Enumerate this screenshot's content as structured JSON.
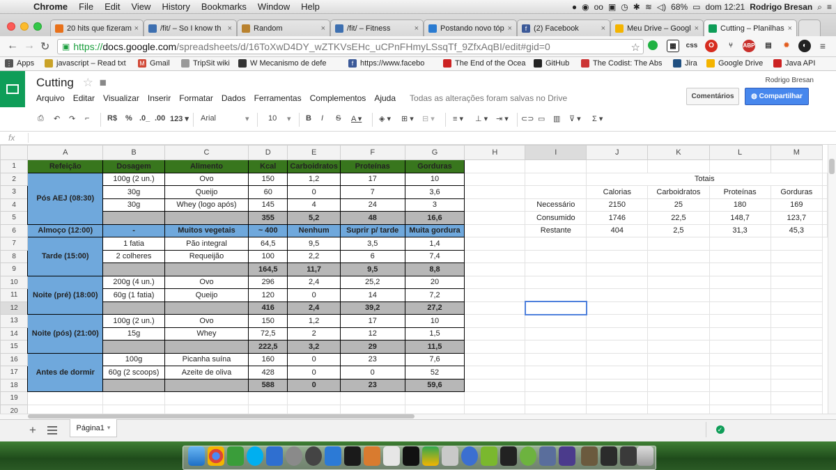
{
  "menubar": {
    "app": "Chrome",
    "items": [
      "File",
      "Edit",
      "View",
      "History",
      "Bookmarks",
      "Window",
      "Help"
    ],
    "battery": "68%",
    "clock": "dom 12:21",
    "user": "Rodrigo Bresan"
  },
  "tabs": [
    {
      "title": "20 hits que fizeram",
      "color": "#e8711a"
    },
    {
      "title": "/fit/ – So I know th",
      "color": "#3d6fb0"
    },
    {
      "title": "Random",
      "color": "#b9822f"
    },
    {
      "title": "/fit/ – Fitness",
      "color": "#3d6fb0"
    },
    {
      "title": "Postando novo tóp",
      "color": "#2a7bd1"
    },
    {
      "title": "(2) Facebook",
      "color": "#3b5998"
    },
    {
      "title": "Meu Drive – Googl",
      "color": "#f4b400"
    },
    {
      "title": "Cutting – Planilhas",
      "color": "#0f9d58"
    }
  ],
  "address": {
    "https": "https://",
    "host": "docs.google.com",
    "path": "/spreadsheets/d/16ToXwD4DY_wZTKVsEHc_uCPnFHmyLSsqTf_9ZfxAqBI/edit#gid=0"
  },
  "bookmarks": [
    {
      "label": "Apps",
      "color": "#555"
    },
    {
      "label": "javascript – Read txt",
      "color": "#c9a227"
    },
    {
      "label": "Gmail",
      "color": "#d14836"
    },
    {
      "label": "TripSit wiki",
      "color": "#999"
    },
    {
      "label": "W  Mecanismo de defe",
      "color": "#333"
    },
    {
      "label": "https://www.facebo",
      "color": "#3b5998"
    },
    {
      "label": "The End of the Ocea",
      "color": "#cc2222"
    },
    {
      "label": "GitHub",
      "color": "#222"
    },
    {
      "label": "The Codist: The Abs",
      "color": "#cc3333"
    },
    {
      "label": "Jira",
      "color": "#205081"
    },
    {
      "label": "Google Drive",
      "color": "#f4b400"
    },
    {
      "label": "Java API",
      "color": "#cc2222"
    }
  ],
  "doc": {
    "title": "Cutting",
    "menus": [
      "Arquivo",
      "Editar",
      "Visualizar",
      "Inserir",
      "Formatar",
      "Dados",
      "Ferramentas",
      "Complementos",
      "Ajuda"
    ],
    "saved": "Todas as alterações foram salvas no Drive",
    "user": "Rodrigo Bresan",
    "comments": "Comentários",
    "share": "Compartilhar"
  },
  "toolbar": {
    "currency": "R$",
    "percent": "%",
    "dec_less": ".0_",
    "dec_more": ".00",
    "format": "123 ▾",
    "font": "Arial",
    "size": "10"
  },
  "formula": {
    "fx": "fx"
  },
  "sheet": {
    "columns": [
      "A",
      "B",
      "C",
      "D",
      "E",
      "F",
      "G",
      "H",
      "I",
      "J",
      "K",
      "L",
      "M"
    ],
    "headers": [
      "Refeição",
      "Dosagem",
      "Alimento",
      "Kcal",
      "Carboidratos",
      "Proteínas",
      "Gorduras"
    ],
    "meals": {
      "pos_aej": "Pós AEJ (08:30)",
      "almoco": "Almoço (12:00)",
      "tarde": "Tarde (15:00)",
      "noite_pre": "Noite (pré) (18:00)",
      "noite_pos": "Noite (pós) (21:00)",
      "antes": "Antes de dormir"
    },
    "rows": {
      "r2": [
        "100g (2 un.)",
        "Ovo",
        "150",
        "1,2",
        "17",
        "10"
      ],
      "r3": [
        "30g",
        "Queijo",
        "60",
        "0",
        "7",
        "3,6"
      ],
      "r4": [
        "30g",
        "Whey (logo após)",
        "145",
        "4",
        "24",
        "3"
      ],
      "r5": [
        "355",
        "5,2",
        "48",
        "16,6"
      ],
      "r6": [
        "-",
        "Muitos vegetais",
        "~ 400",
        "Nenhum",
        "Suprir p/ tarde",
        "Muita gordura"
      ],
      "r7": [
        "1 fatia",
        "Pão integral",
        "64,5",
        "9,5",
        "3,5",
        "1,4"
      ],
      "r8": [
        "2 colheres",
        "Requeijão",
        "100",
        "2,2",
        "6",
        "7,4"
      ],
      "r9": [
        "164,5",
        "11,7",
        "9,5",
        "8,8"
      ],
      "r10": [
        "200g (4 un.)",
        "Ovo",
        "296",
        "2,4",
        "25,2",
        "20"
      ],
      "r11": [
        "60g (1 fatia)",
        "Queijo",
        "120",
        "0",
        "14",
        "7,2"
      ],
      "r12": [
        "416",
        "2,4",
        "39,2",
        "27,2"
      ],
      "r13": [
        "100g (2 un.)",
        "Ovo",
        "150",
        "1,2",
        "17",
        "10"
      ],
      "r14": [
        "15g",
        "Whey",
        "72,5",
        "2",
        "12",
        "1,5"
      ],
      "r15": [
        "222,5",
        "3,2",
        "29",
        "11,5"
      ],
      "r16": [
        "100g",
        "Picanha suína",
        "160",
        "0",
        "23",
        "7,6"
      ],
      "r17": [
        "60g (2 scoops)",
        "Azeite de oliva",
        "428",
        "0",
        "0",
        "52"
      ],
      "r18": [
        "588",
        "0",
        "23",
        "59,6"
      ]
    },
    "totals": {
      "title": "Totais",
      "cols": [
        "Calorias",
        "Carboidratos",
        "Proteínas",
        "Gorduras"
      ],
      "necessario": {
        "label": "Necessário",
        "values": [
          "2150",
          "25",
          "180",
          "169"
        ]
      },
      "consumido": {
        "label": "Consumido",
        "values": [
          "1746",
          "22,5",
          "148,7",
          "123,7"
        ]
      },
      "restante": {
        "label": "Restante",
        "values": [
          "404",
          "2,5",
          "31,3",
          "45,3"
        ]
      }
    }
  },
  "sheet_tab": "Página1"
}
